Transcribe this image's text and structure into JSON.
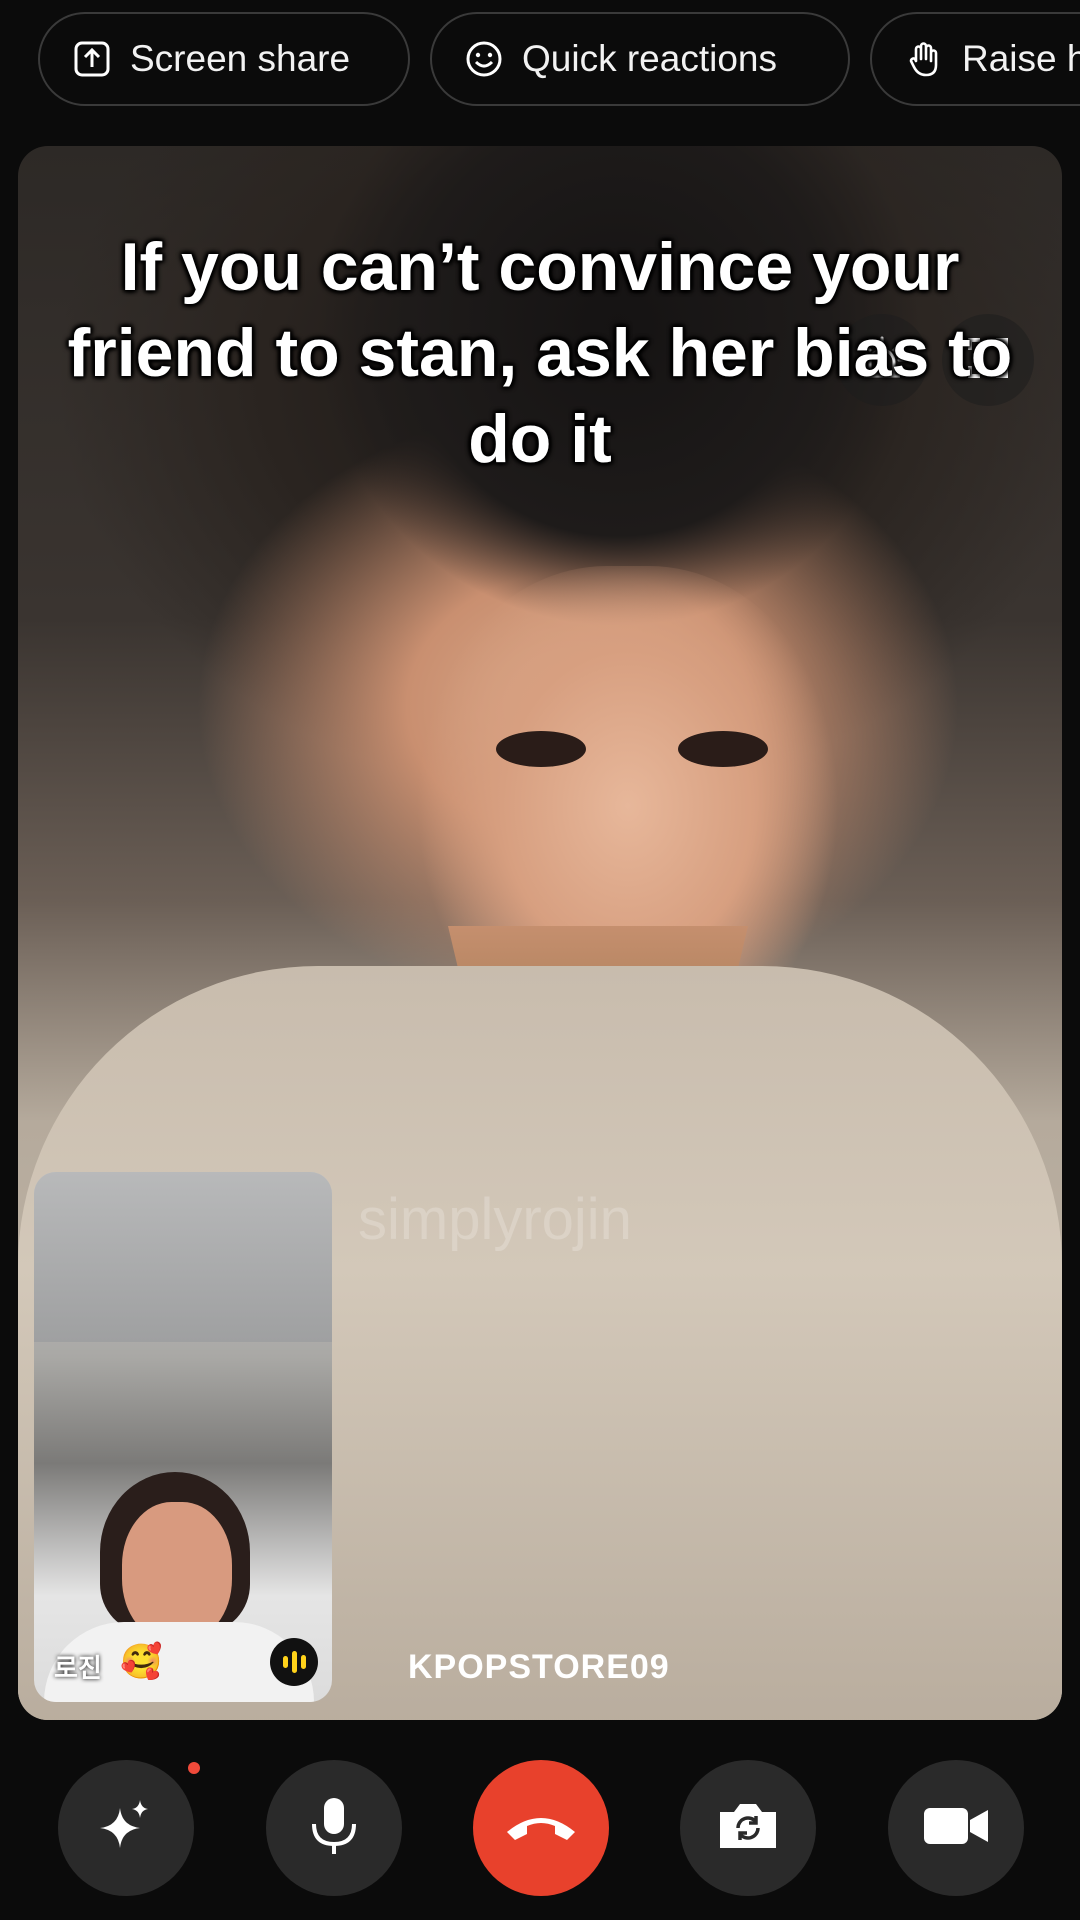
{
  "top_bar": {
    "actions": [
      {
        "label": "Screen share",
        "icon": "screen-share-icon"
      },
      {
        "label": "Quick reactions",
        "icon": "smiley-icon"
      },
      {
        "label": "Raise h",
        "icon": "hand-icon"
      }
    ]
  },
  "video": {
    "caption": "If you can’t convince your friend to stan, ask her bias to do it",
    "watermark": "simplyrojin",
    "callee_name": "KPOPSTORE09",
    "top_icons": [
      "alert-light-icon",
      "fullscreen-icon"
    ]
  },
  "self_view": {
    "name": "로진",
    "emoji": "🥰",
    "audio_indicator": "active"
  },
  "controls": [
    {
      "name": "effects",
      "icon": "sparkle-icon",
      "has_notification": true
    },
    {
      "name": "microphone",
      "icon": "mic-icon"
    },
    {
      "name": "end-call",
      "icon": "phone-hangup-icon",
      "color": "#e8412c"
    },
    {
      "name": "flip-camera",
      "icon": "flip-camera-icon"
    },
    {
      "name": "video",
      "icon": "video-camera-icon"
    }
  ]
}
